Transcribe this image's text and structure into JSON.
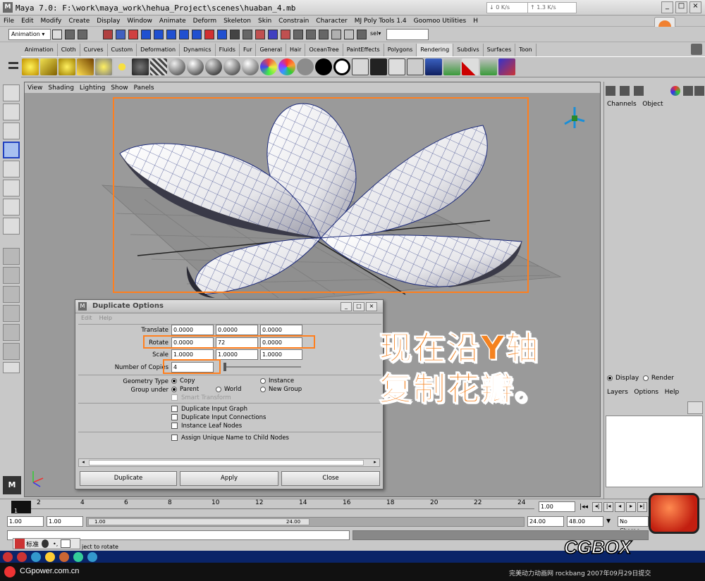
{
  "window": {
    "title": "Maya 7.0: F:\\work\\maya_work\\hehua_Project\\scenes\\huaban_4.mb",
    "net_down": "0 K/s",
    "net_up": "1.3 K/s"
  },
  "menu": [
    "File",
    "Edit",
    "Modify",
    "Create",
    "Display",
    "Window",
    "Animate",
    "Deform",
    "Skeleton",
    "Skin",
    "Constrain",
    "Character",
    "MJ Poly Tools 1.4",
    "Goomoo Utilities",
    "H"
  ],
  "status": {
    "mode": "Animation",
    "sel_label": "sel▾"
  },
  "shelf_tabs": [
    "Animation",
    "Cloth",
    "Curves",
    "Custom",
    "Deformation",
    "Dynamics",
    "Fluids",
    "Fur",
    "General",
    "Hair",
    "OceanTree",
    "PaintEffects",
    "Polygons",
    "Rendering",
    "Subdivs",
    "Surfaces",
    "Toon"
  ],
  "shelf_active": "Rendering",
  "viewport": {
    "menu": [
      "View",
      "Shading",
      "Lighting",
      "Show",
      "Panels"
    ]
  },
  "channel_box": {
    "tabs": [
      "Channels",
      "Object"
    ],
    "layer_display": "Display",
    "layer_render": "Render",
    "layer_menu": [
      "Layers",
      "Options",
      "Help"
    ]
  },
  "dialog": {
    "title": "Duplicate Options",
    "menu": [
      "Edit",
      "Help"
    ],
    "translate_label": "Translate",
    "translate": [
      "0.0000",
      "0.0000",
      "0.0000"
    ],
    "rotate_label": "Rotate",
    "rotate": [
      "0.0000",
      "72",
      "0.0000"
    ],
    "scale_label": "Scale",
    "scale": [
      "1.0000",
      "1.0000",
      "1.0000"
    ],
    "copies_label": "Number of Copies",
    "copies": "4",
    "geometry_type_label": "Geometry Type",
    "geometry_copy": "Copy",
    "geometry_instance": "Instance",
    "group_under_label": "Group under",
    "group_parent": "Parent",
    "group_world": "World",
    "group_new": "New Group",
    "smart_transform": "Smart Transform",
    "dup_input_graph": "Duplicate Input Graph",
    "dup_input_conn": "Duplicate Input Connections",
    "instance_leaf": "Instance Leaf Nodes",
    "assign_unique": "Assign Unique Name to Child Nodes",
    "btn_duplicate": "Duplicate",
    "btn_apply": "Apply",
    "btn_close": "Close"
  },
  "annotation": [
    "现在沿Y轴",
    "复制花瓣。"
  ],
  "timeline": {
    "ticks": [
      "1",
      "2",
      "4",
      "6",
      "8",
      "10",
      "12",
      "14",
      "16",
      "18",
      "20",
      "22",
      "24"
    ],
    "current": "1.00"
  },
  "range": {
    "start": "1.00",
    "start2": "1.00",
    "end": "24.00",
    "end2": "48.00",
    "slider_left": "1.00",
    "slider_right": "24.00",
    "character": "No Charac"
  },
  "cmdline": {
    "ime": "标准",
    "help": "ject to rotate"
  },
  "footer": {
    "left": "CGpower.com.cn",
    "right": "完美动力动画网 rockbang 2007年09月29日提交",
    "logo": "CGBOX"
  },
  "colors": {
    "highlight": "#ff7f1e",
    "annotation": "#f5821f",
    "mesh": "#202a6a"
  }
}
